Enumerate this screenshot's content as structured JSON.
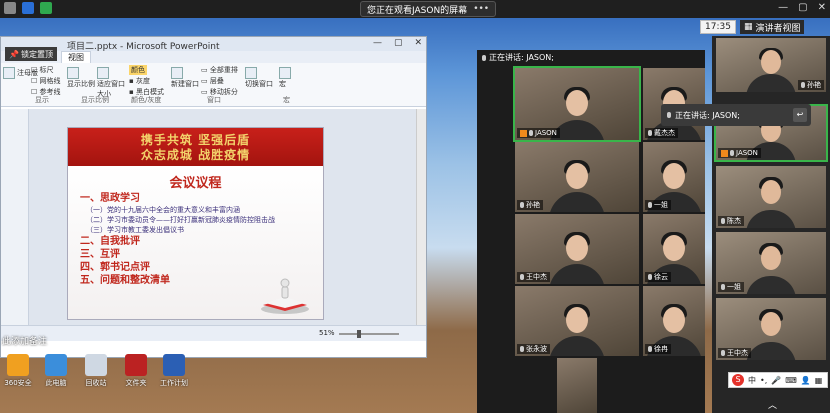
{
  "topbar": {
    "share_text": "您正在观看JASON的屏幕",
    "share_dots": "•••",
    "min": "—",
    "max": "▢",
    "close": "✕"
  },
  "viewbar": {
    "time": "17:35",
    "speaker_view": "演讲者视图"
  },
  "ppt": {
    "window_title": "项目二.pptx - Microsoft PowerPoint",
    "pin_label": "锁定置顶",
    "tab_view": "视图",
    "ribbon": {
      "ruler": "标尺",
      "gridlines": "网格线",
      "guides": "参考线",
      "show_ratio": "显示比例",
      "fit_window": "适应窗口大小",
      "color": "颜色",
      "grayscale": "灰度",
      "black_white": "黑白模式",
      "new_window": "新建窗口",
      "arrange_all": "全部重排",
      "cascade": "层叠",
      "move_split": "移动拆分",
      "switch_window": "切换窗口",
      "macro": "宏",
      "group_show": "显示",
      "group_ratio": "显示比例",
      "group_color": "颜色/灰度",
      "group_window": "窗口",
      "group_macro": "宏",
      "left_label": "注母版"
    },
    "slide": {
      "banner_line1": "携手共筑 坚强后盾",
      "banner_line2": "众志成城 战胜疫情",
      "agenda_title": "会议议程",
      "items": [
        {
          "heading": "一、思政学习",
          "subs": [
            "（一）党的十九届六中全会的重大意义和丰富内涵",
            "（二）学习市委动员令——打好打赢新冠肺炎疫情防控阻击战",
            "（三）学习市教工委发出倡议书"
          ]
        },
        {
          "heading": "二、自我批评",
          "subs": []
        },
        {
          "heading": "三、互评",
          "subs": []
        },
        {
          "heading": "四、郭书记点评",
          "subs": []
        },
        {
          "heading": "五、问题和整改清单",
          "subs": []
        }
      ]
    },
    "status_zoom": "51%",
    "notes": "此添加备注"
  },
  "desktop": {
    "icons": [
      "360安全",
      "此电脑",
      "回收站",
      "文件夹",
      "工作计划"
    ]
  },
  "meeting": {
    "speaking_label": "正在讲话: JASON;",
    "tiles": [
      "JASON",
      "戴杰杰",
      "孙艳",
      "一姐",
      "王中杰",
      "徐云",
      "张永波",
      "徐冉"
    ]
  },
  "rightcol": {
    "tiles": [
      "孙艳",
      "JASON",
      "陈杰",
      "一姐",
      "王中杰",
      "",
      ""
    ]
  },
  "popup": {
    "text": "正在讲话: JASON;",
    "back": "↩"
  },
  "ime": {
    "logo": "S",
    "mode": "中",
    "punct": "•,",
    "mic": "🎤",
    "keyboard": "⌨",
    "user": "👤",
    "grid": "▦"
  },
  "taskbar": {
    "chevron": "︿"
  }
}
